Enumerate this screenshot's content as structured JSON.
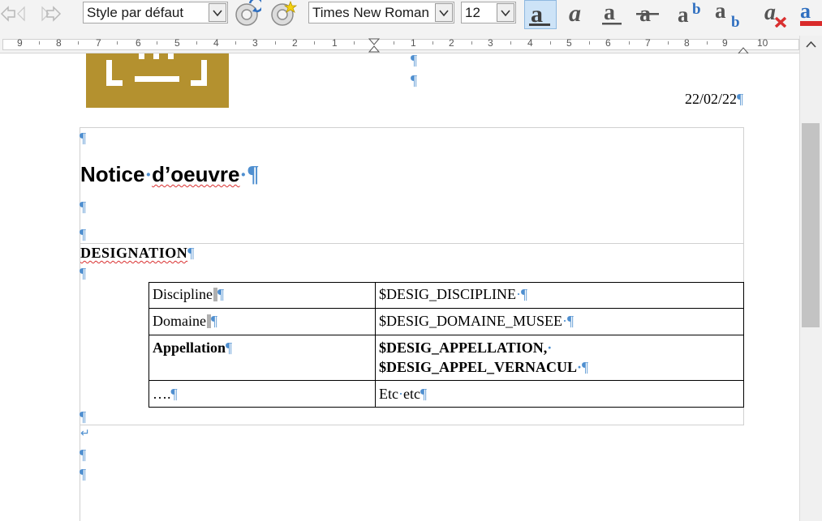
{
  "toolbar": {
    "paragraph_style": "Style par défaut",
    "font_name": "Times New Roman",
    "font_size": "12"
  },
  "ruler": {
    "labels": [
      "9",
      "8",
      "7",
      "6",
      "5",
      "4",
      "3",
      "2",
      "1",
      "1",
      "2",
      "3",
      "4",
      "5",
      "6",
      "7",
      "8",
      "9",
      "10"
    ]
  },
  "document": {
    "date": "22/02/22",
    "heading_word1": "Notice",
    "heading_word2": "d’oeuvre",
    "section_label": "DESIGNATION",
    "pilcrow": "¶",
    "nbsp_dot": "·",
    "line_break": "↵",
    "table": {
      "rows": [
        {
          "label": "Discipline",
          "value": "$DESIG_DISCIPLINE"
        },
        {
          "label": "Domaine",
          "value": "$DESIG_DOMAINE_MUSEE"
        },
        {
          "label": "Appellation",
          "value_line1": "$DESIG_APPELLATION,",
          "value_line2": "$DESIG_APPEL_VERNACUL"
        },
        {
          "label": "….",
          "value_word1": "Etc",
          "value_word2": "etc"
        }
      ]
    }
  },
  "colors": {
    "logo_gold": "#b4912f",
    "formatting_marks": "#4f8fd0",
    "spell_error": "#d93030"
  }
}
